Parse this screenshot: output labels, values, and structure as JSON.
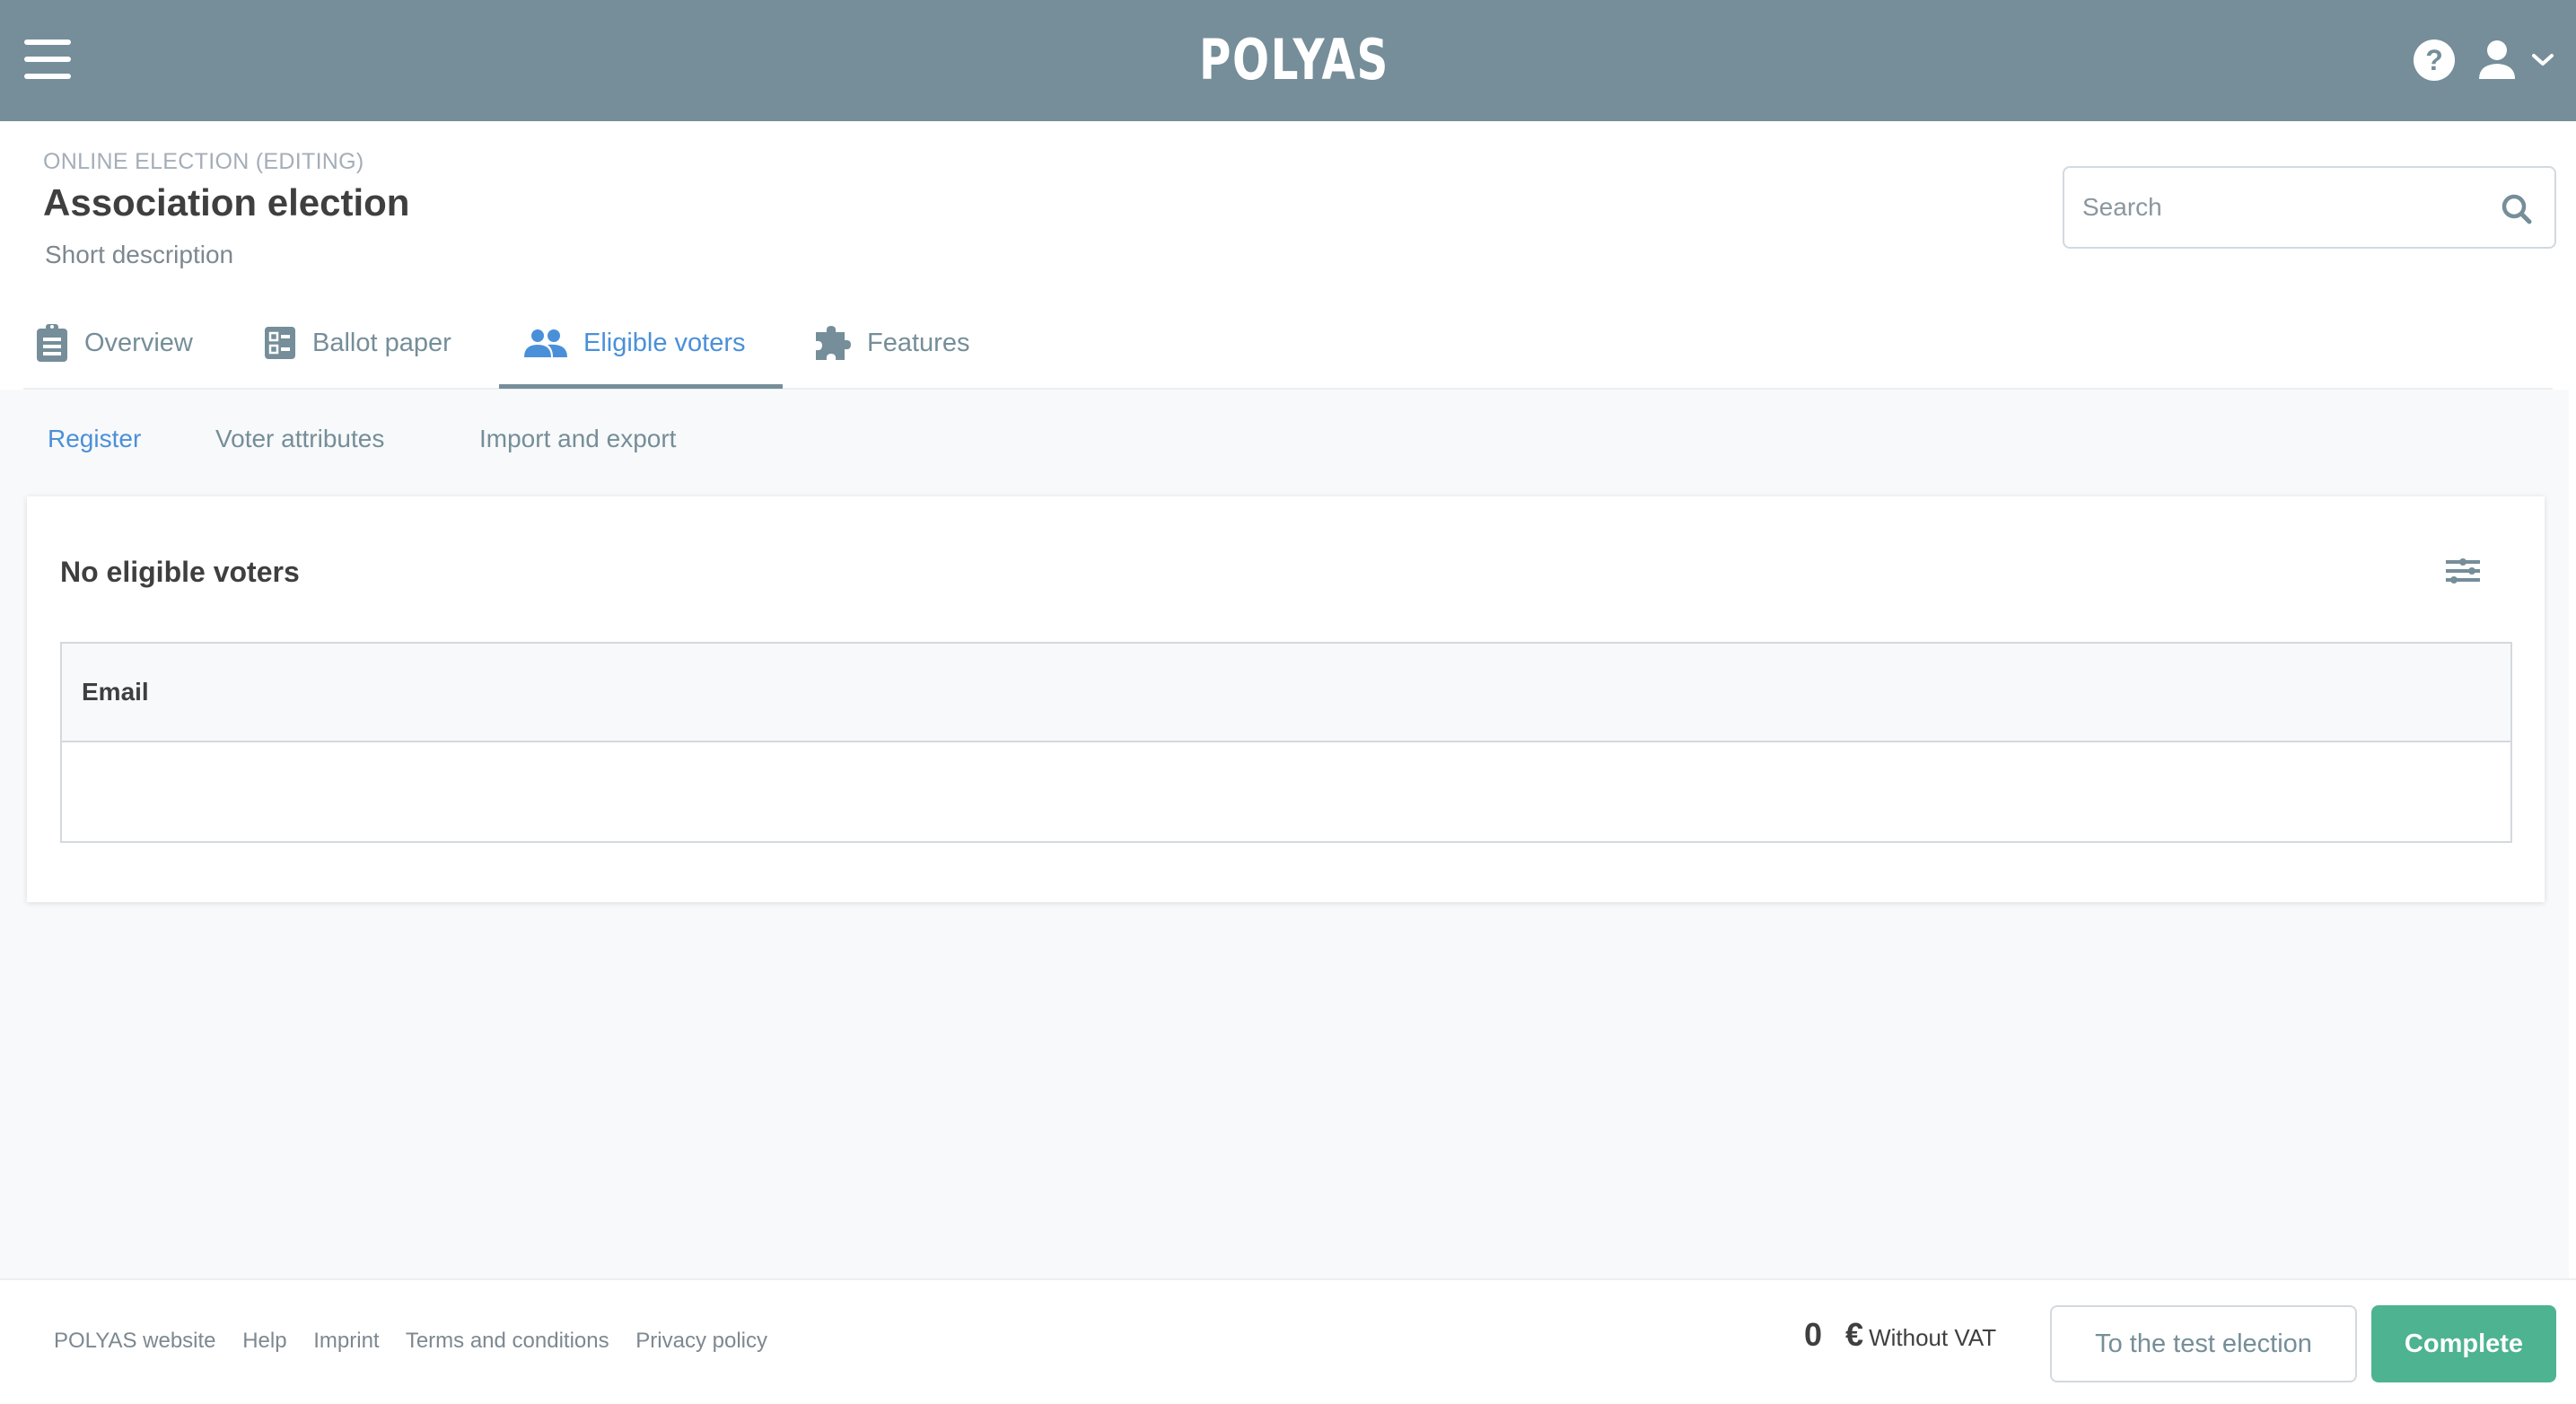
{
  "topbar": {
    "logo": "POLYAS",
    "help_icon": "?",
    "menu_icon": "hamburger-menu-icon",
    "user_icon": "user-icon",
    "dropdown_icon": "chevron-down-icon"
  },
  "header": {
    "election_type": "ONLINE ELECTION (EDITING)",
    "title": "Association election",
    "description": "Short description"
  },
  "search": {
    "placeholder": "Search",
    "value": "",
    "icon": "search-icon"
  },
  "tabs": [
    {
      "label": "Overview",
      "icon": "clipboard-icon",
      "active": false
    },
    {
      "label": "Ballot paper",
      "icon": "ballot-list-icon",
      "active": false
    },
    {
      "label": "Eligible voters",
      "icon": "people-icon",
      "active": true
    },
    {
      "label": "Features",
      "icon": "puzzle-icon",
      "active": false
    }
  ],
  "subtabs": [
    {
      "label": "Register",
      "active": true
    },
    {
      "label": "Voter attributes",
      "active": false
    },
    {
      "label": "Import and export",
      "active": false
    }
  ],
  "card": {
    "title": "No eligible voters",
    "settings_icon": "sliders-icon",
    "table": {
      "columns": [
        "Email"
      ],
      "rows": []
    }
  },
  "footer": {
    "links": [
      "POLYAS website",
      "Help",
      "Imprint",
      "Terms and conditions",
      "Privacy policy"
    ],
    "price_value": "0",
    "price_currency": "€",
    "price_note": "Without VAT",
    "test_button": "To the test election",
    "complete_button": "Complete"
  },
  "colors": {
    "topbar": "#758e99",
    "accent_blue": "#4a90d9",
    "primary_green": "#4db391",
    "muted_text": "#758e99"
  }
}
